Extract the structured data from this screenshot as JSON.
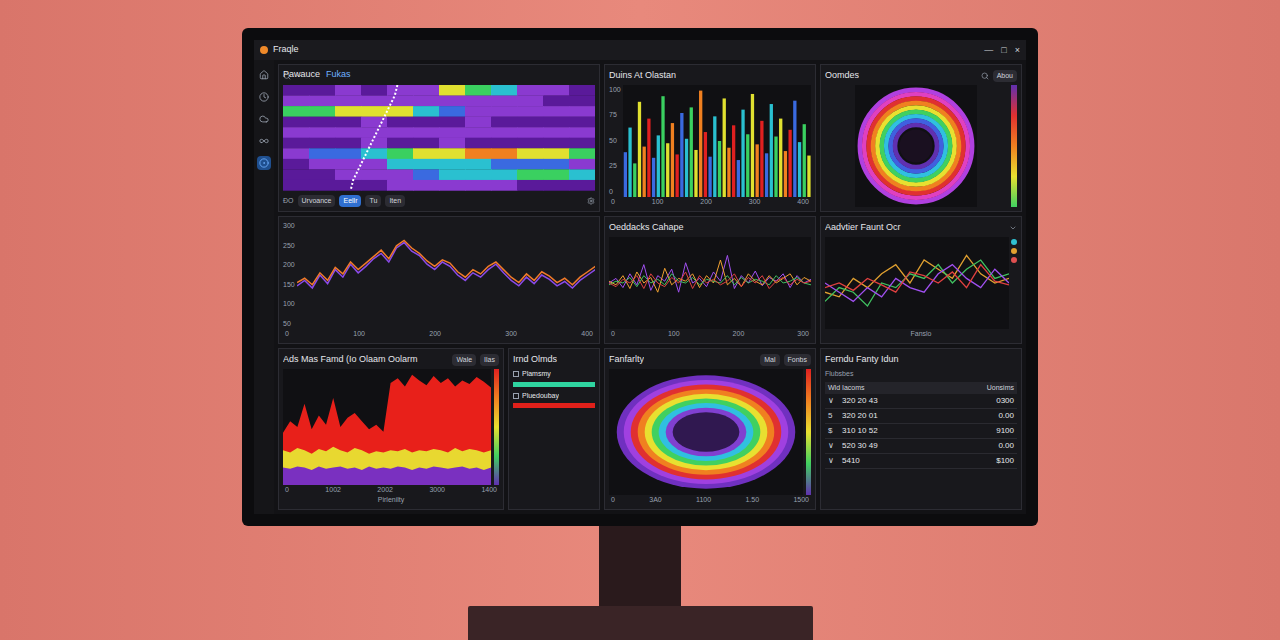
{
  "window": {
    "title": "Fraqle",
    "controls": [
      "—",
      "□",
      "×"
    ]
  },
  "sidebar": {
    "items": [
      {
        "selected": false
      },
      {
        "selected": false
      },
      {
        "selected": false
      },
      {
        "selected": false
      },
      {
        "selected": true
      }
    ]
  },
  "spectrogram": {
    "tabs": [
      {
        "label": "Pawauce",
        "selected": false
      },
      {
        "label": "Fukas",
        "selected": true
      }
    ],
    "rows": [
      [
        0.1,
        0.15,
        0.2,
        0.15,
        0.2,
        0.3,
        0.7,
        0.6,
        0.5,
        0.3,
        0.2,
        0.15
      ],
      [
        0.2,
        0.2,
        0.25,
        0.3,
        0.2,
        0.2,
        0.3,
        0.25,
        0.2,
        0.2,
        0.15,
        0.1
      ],
      [
        0.6,
        0.65,
        0.7,
        0.75,
        0.8,
        0.5,
        0.4,
        0.3,
        0.3,
        0.25,
        0.2,
        0.2
      ],
      [
        0.1,
        0.15,
        0.1,
        0.2,
        0.15,
        0.1,
        0.15,
        0.2,
        0.1,
        0.15,
        0.1,
        0.1
      ],
      [
        0.2,
        0.3,
        0.25,
        0.2,
        0.3,
        0.25,
        0.2,
        0.3,
        0.25,
        0.2,
        0.3,
        0.2
      ],
      [
        0.1,
        0.1,
        0.15,
        0.2,
        0.15,
        0.1,
        0.2,
        0.15,
        0.1,
        0.1,
        0.15,
        0.1
      ],
      [
        0.3,
        0.35,
        0.4,
        0.45,
        0.6,
        0.7,
        0.8,
        0.85,
        0.85,
        0.8,
        0.7,
        0.6
      ],
      [
        0.15,
        0.2,
        0.25,
        0.3,
        0.45,
        0.55,
        0.5,
        0.45,
        0.4,
        0.4,
        0.35,
        0.3
      ],
      [
        0.1,
        0.15,
        0.2,
        0.25,
        0.3,
        0.4,
        0.45,
        0.5,
        0.55,
        0.6,
        0.6,
        0.55
      ],
      [
        0.1,
        0.1,
        0.15,
        0.15,
        0.2,
        0.2,
        0.25,
        0.2,
        0.2,
        0.15,
        0.15,
        0.1
      ]
    ],
    "trace": [
      4.4,
      4.3,
      4.1,
      3.9,
      3.7,
      3.5,
      3.3,
      3.1,
      2.9,
      2.7,
      2.6
    ]
  },
  "filters": {
    "label": "ĐO",
    "chips": [
      {
        "label": "Urvoance",
        "selected": false
      },
      {
        "label": "Eellr",
        "selected": true
      },
      {
        "label": "Tu",
        "selected": false
      },
      {
        "label": "Iten",
        "selected": false
      }
    ]
  },
  "wave_chart": {
    "y_ticks": [
      "300",
      "250",
      "200",
      "150",
      "100",
      "50"
    ],
    "x_ticks": [
      "0",
      "100",
      "200",
      "300",
      "400"
    ],
    "series": [
      {
        "color": "#8a4ae8",
        "values": [
          40,
          45,
          38,
          50,
          42,
          55,
          48,
          60,
          52,
          58,
          65,
          70,
          62,
          75,
          80,
          72,
          68,
          60,
          55,
          62,
          58,
          50,
          45,
          52,
          48,
          55,
          60,
          52,
          45,
          40,
          48,
          42,
          50,
          46,
          40,
          44,
          38,
          45,
          50,
          55
        ]
      },
      {
        "color": "#f07a2a",
        "values": [
          43,
          47,
          41,
          52,
          45,
          57,
          51,
          62,
          55,
          61,
          67,
          73,
          65,
          77,
          82,
          75,
          70,
          63,
          58,
          64,
          61,
          53,
          48,
          55,
          51,
          58,
          62,
          55,
          48,
          43,
          51,
          45,
          53,
          49,
          43,
          47,
          41,
          48,
          53,
          58
        ]
      }
    ]
  },
  "bar_chart": {
    "title": "Duins At Olastan",
    "y_ticks": [
      "100",
      "75",
      "50",
      "25",
      "0"
    ],
    "x_ticks": [
      "0",
      "100",
      "200",
      "300",
      "400"
    ],
    "values": [
      40,
      62,
      30,
      85,
      45,
      70,
      35,
      55,
      90,
      48,
      66,
      38,
      75,
      52,
      80,
      42,
      95,
      58,
      36,
      72,
      50,
      88,
      44,
      64,
      33,
      78,
      56,
      92,
      47,
      68,
      39,
      83,
      54,
      70,
      41,
      60,
      86,
      49,
      65,
      37
    ]
  },
  "donut": {
    "title": "Oomdes",
    "button": "Abou",
    "rings": [
      "#b040e0",
      "#e040c0",
      "#e03030",
      "#f08020",
      "#e8e030",
      "#40d060",
      "#30c0e0",
      "#4060e0",
      "#6030b0"
    ]
  },
  "line_chart_a": {
    "title": "Oeddacks Cahape",
    "x_ticks": [
      "0",
      "100",
      "200",
      "300"
    ],
    "series": [
      {
        "color": "#a050f0",
        "values": [
          50,
          55,
          45,
          60,
          48,
          70,
          42,
          58,
          52,
          65,
          40,
          72,
          50,
          55,
          46,
          62,
          52,
          80,
          44,
          58,
          50,
          63,
          47,
          56,
          52,
          60,
          45,
          58,
          50,
          54
        ]
      },
      {
        "color": "#f0a030",
        "values": [
          52,
          48,
          58,
          44,
          62,
          50,
          56,
          40,
          66,
          48,
          55,
          52,
          60,
          45,
          58,
          50,
          75,
          48,
          55,
          46,
          60,
          52,
          48,
          58,
          50,
          55,
          60,
          48,
          56,
          52
        ]
      },
      {
        "color": "#40c060",
        "values": [
          48,
          52,
          50,
          56,
          46,
          58,
          50,
          54,
          48,
          60,
          52,
          50,
          56,
          48,
          54,
          52,
          50,
          58,
          48,
          56,
          50,
          54,
          52,
          48,
          58,
          50,
          52,
          56,
          50,
          48
        ]
      },
      {
        "color": "#e04040",
        "values": [
          50,
          46,
          54,
          50,
          58,
          44,
          60,
          50,
          46,
          56,
          50,
          62,
          44,
          58,
          50,
          54,
          48,
          52,
          60,
          46,
          56,
          50,
          58,
          44,
          52,
          56,
          48,
          54,
          50,
          52
        ]
      }
    ]
  },
  "line_chart_b": {
    "title": "Aadvtier Faunt Ocr",
    "x_label": "Fanslo",
    "legend": [
      {
        "color": "#30c0d0"
      },
      {
        "color": "#e0a030"
      },
      {
        "color": "#e05050"
      }
    ],
    "series": [
      {
        "color": "#e0a030",
        "values": [
          40,
          35,
          55,
          45,
          60,
          70,
          50,
          75,
          65,
          55,
          80,
          60,
          50,
          55
        ]
      },
      {
        "color": "#40c060",
        "values": [
          30,
          45,
          40,
          25,
          50,
          45,
          60,
          55,
          70,
          50,
          65,
          75,
          55,
          60
        ]
      },
      {
        "color": "#a050f0",
        "values": [
          50,
          40,
          30,
          45,
          35,
          55,
          45,
          40,
          60,
          70,
          55,
          45,
          65,
          50
        ]
      },
      {
        "color": "#e04040",
        "values": [
          45,
          50,
          42,
          55,
          48,
          40,
          62,
          58,
          50,
          62,
          45,
          70,
          52,
          48
        ]
      }
    ]
  },
  "area_chart": {
    "title": "Ads Mas Famd (Io Olaam Oolarm",
    "chips": [
      "Wale",
      "Ilas"
    ],
    "x_ticks": [
      "0",
      "1002",
      "2002",
      "3000",
      "1400"
    ],
    "x_label": "Pirlenilty",
    "red": [
      45,
      55,
      50,
      70,
      48,
      60,
      52,
      75,
      50,
      58,
      62,
      55,
      48,
      52,
      46,
      88,
      92,
      85,
      95,
      90,
      86,
      94,
      88,
      92,
      85,
      90,
      87,
      93,
      89,
      84
    ],
    "yellow": [
      30,
      28,
      32,
      30,
      27,
      31,
      29,
      33,
      30,
      28,
      32,
      30,
      27,
      29,
      28,
      30,
      29,
      31,
      28,
      30,
      29,
      31,
      30,
      28,
      32,
      29,
      31,
      30,
      28,
      30
    ],
    "purple": [
      15,
      14,
      16,
      15,
      13,
      16,
      14,
      15,
      16,
      14,
      15,
      13,
      16,
      14,
      15,
      14,
      16,
      15,
      13,
      15,
      14,
      16,
      15,
      14,
      15,
      16,
      14,
      15,
      13,
      15
    ]
  },
  "legend_panel": {
    "title": "Irnd Olmds",
    "items": [
      {
        "label": "Plamsmy",
        "color": "#2fd4a0"
      },
      {
        "label": "Pluedoubay",
        "color": "#e0201a"
      }
    ]
  },
  "heatmap": {
    "title": "Fanfarlty",
    "buttons": [
      "Mal",
      "Fonbs"
    ],
    "x_ticks": [
      "0",
      "3A0",
      "1100",
      "1.50",
      "1500"
    ],
    "rings": [
      "#7030c0",
      "#a040e0",
      "#e03030",
      "#f08020",
      "#e8e030",
      "#40d060",
      "#30c0e0",
      "#8040d0",
      "#301850"
    ]
  },
  "table": {
    "title": "Ferndu Fanty Idun",
    "subtitle": "Flubsbes",
    "columns": [
      "Wld Iacoms",
      "Uonsims"
    ],
    "rows": [
      {
        "marker": "∨",
        "label": "320 20 43",
        "value": "0300"
      },
      {
        "marker": "5",
        "label": "320 20 01",
        "value": "0.00"
      },
      {
        "marker": "$",
        "label": "310 10 52",
        "value": "9100"
      },
      {
        "marker": "∨",
        "label": "520 30 49",
        "value": "0.00"
      },
      {
        "marker": "∨",
        "label": "5410",
        "value": "$100"
      }
    ]
  }
}
